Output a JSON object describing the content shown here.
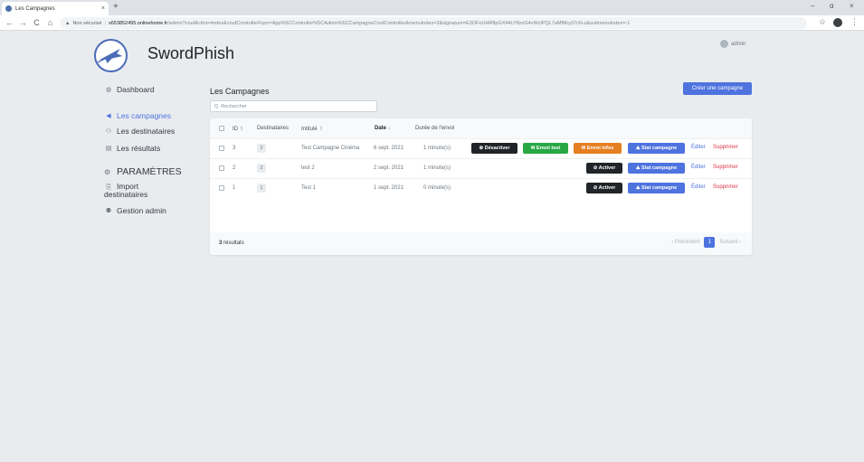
{
  "browser": {
    "tab_title": "Les Campagnes",
    "tab_close": "×",
    "new_tab": "+",
    "not_secure": "Non sécurisé",
    "url_host": "s653852495.onlinehome.fr",
    "url_path": "/admin?crudAction=index&crudControllerFqcn=App%5CController%5CAdmin%5CCampagneCrudController&menuIndex=2&signature=E3OFoUHRftpGX44LY8zzG4vWclPQL7aMfMry37cN-s&submenuIndex=-1",
    "win_min": "–",
    "win_max": "ɑ",
    "win_close": "×",
    "back": "←",
    "forward": "→",
    "reload": "C",
    "home": "⌂",
    "star": "☆",
    "menu": "⋮"
  },
  "header": {
    "brand": "SwordPhish",
    "user": "admin"
  },
  "sidebar": {
    "items": [
      {
        "label": "Dashboard",
        "icon": "dashboard-icon"
      },
      {
        "label": "Les campagnes",
        "icon": "paper-plane-icon"
      },
      {
        "label": "Les destinataires",
        "icon": "users-icon"
      },
      {
        "label": "Les résultats",
        "icon": "list-icon"
      }
    ],
    "section": {
      "label": "PARAMÈTRES",
      "icon": "gear-icon"
    },
    "settings_items": [
      {
        "label": "Import",
        "label2": "destinataires",
        "icon": "file-import-icon"
      },
      {
        "label": "Gestion admin",
        "icon": "user-cog-icon"
      }
    ]
  },
  "main": {
    "title": "Les Campagnes",
    "create_button": "Créer une campagne",
    "search_placeholder": "Rechercher",
    "search_icon": "Q",
    "columns": {
      "id": "ID",
      "destinataires": "Destinataires",
      "intitule": "Intitulé",
      "date": "Date",
      "duree": "Durée de l'envoi",
      "sort_arrow": "⇕",
      "sort_down": "↓"
    },
    "rows": [
      {
        "id": "3",
        "dest": "2",
        "intitule": "Test Campagne Cinéma",
        "date": "6 sept. 2021",
        "duree": "1 minute(s)",
        "toggle": "⊗ Désactiver",
        "envoi_test": "✉ Envoi test",
        "envoi_infos": "✉ Envoi infos",
        "stat": "⛰ Stat campagne",
        "edit": "Éditer",
        "delete": "Supprimer"
      },
      {
        "id": "2",
        "dest": "2",
        "intitule": "test 2",
        "date": "2 sept. 2021",
        "duree": "1 minute(s)",
        "toggle": "⊘ Activer",
        "stat": "⛰ Stat campagne",
        "edit": "Éditer",
        "delete": "Supprimer"
      },
      {
        "id": "1",
        "dest": "1",
        "intitule": "Test 1",
        "date": "1 sept. 2021",
        "duree": "0 minute(s)",
        "toggle": "⊘ Activer",
        "stat": "⛰ Stat campagne",
        "edit": "Éditer",
        "delete": "Supprimer"
      }
    ],
    "footer": {
      "count": "3",
      "results_label": "résultats",
      "prev": "‹ Précédent",
      "page": "1",
      "next": "Suivant ›"
    }
  },
  "colors": {
    "accent": "#4e73df",
    "dark": "#212529",
    "green": "#28a745",
    "orange": "#e67e22",
    "danger": "#dc3545"
  }
}
